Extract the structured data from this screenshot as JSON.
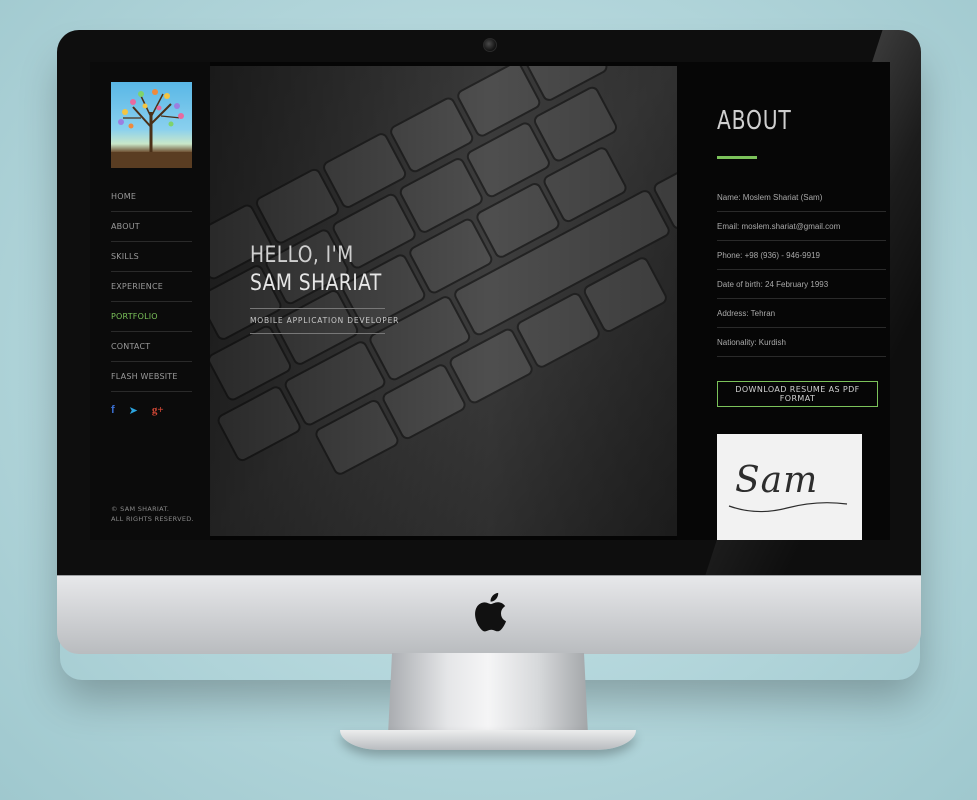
{
  "sidebar": {
    "nav": [
      {
        "label": "HOME",
        "active": false
      },
      {
        "label": "ABOUT",
        "active": false
      },
      {
        "label": "SKILLS",
        "active": false
      },
      {
        "label": "EXPERIENCE",
        "active": false
      },
      {
        "label": "PORTFOLIO",
        "active": true
      },
      {
        "label": "CONTACT",
        "active": false
      },
      {
        "label": "FLASH WEBSITE",
        "active": false
      }
    ],
    "social": [
      {
        "icon": "facebook-icon",
        "glyph": "f",
        "color": "#3b6fd1"
      },
      {
        "icon": "telegram-icon",
        "glyph": "➤",
        "color": "#2ca5e0"
      },
      {
        "icon": "google-plus-icon",
        "glyph": "g+",
        "color": "#d34836"
      }
    ],
    "copyright_line1": "© SAM SHARIAT.",
    "copyright_line2": "ALL RIGHTS RESERVED."
  },
  "hero": {
    "greeting": "HELLO, I'M",
    "name": "SAM SHARIAT",
    "role": "MOBILE APPLICATION DEVELOPER"
  },
  "about": {
    "title": "ABOUT",
    "info": [
      "Name: Moslem Shariat (Sam)",
      "Email: moslem.shariat@gmail.com",
      "Phone: +98 (936) - 946-9919",
      "Date of birth: 24 February 1993",
      "Address: Tehran",
      "Nationality: Kurdish"
    ],
    "download_label": "DOWNLOAD RESUME AS PDF FORMAT",
    "signature": "Sam"
  },
  "colors": {
    "accent": "#7bc25a",
    "background": "#b3d6db"
  }
}
